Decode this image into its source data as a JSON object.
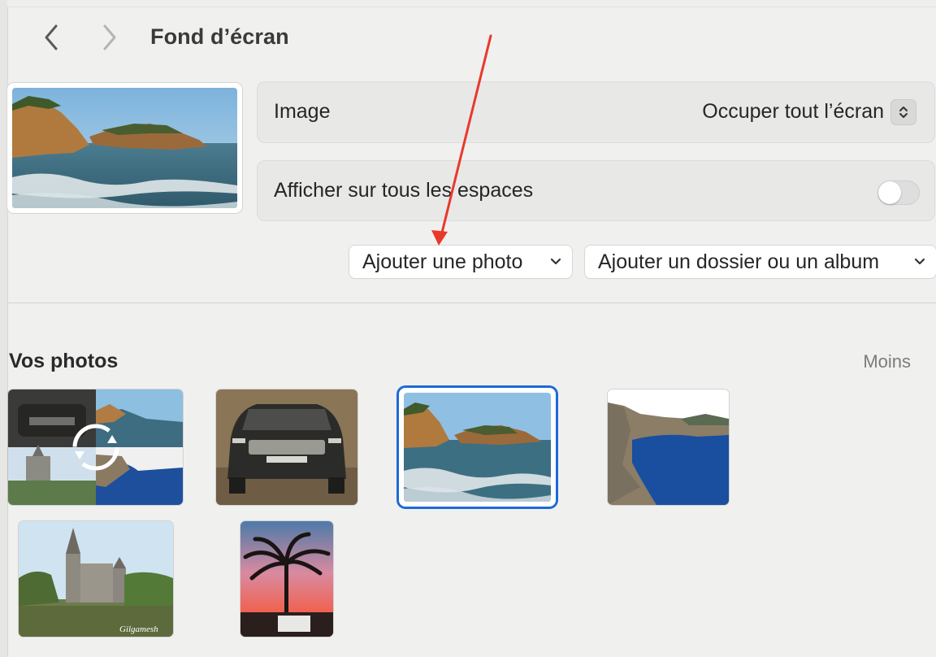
{
  "window": {
    "title": "Fond d’écran"
  },
  "nav": {
    "back_icon": "chevron-left-icon",
    "forward_icon": "chevron-right-icon"
  },
  "settings": {
    "image_label": "Image",
    "fill_mode_value": "Occuper tout l’écran",
    "all_spaces_label": "Afficher sur tous les espaces",
    "all_spaces_enabled": false
  },
  "buttons": {
    "add_photo": "Ajouter une photo",
    "add_folder": "Ajouter un dossier ou un album"
  },
  "photos": {
    "section_title": "Vos photos",
    "less_link": "Moins",
    "items": [
      {
        "name": "shuffle-collage",
        "selected": false
      },
      {
        "name": "car",
        "selected": false
      },
      {
        "name": "rocky-coast",
        "selected": true
      },
      {
        "name": "blue-bay",
        "selected": false
      },
      {
        "name": "temple-river",
        "selected": false,
        "watermark": "Gilgamesh"
      },
      {
        "name": "palm-sunset",
        "selected": false
      }
    ]
  },
  "colors": {
    "accent": "#1d6ad6",
    "annotation_arrow": "#e8392b"
  }
}
